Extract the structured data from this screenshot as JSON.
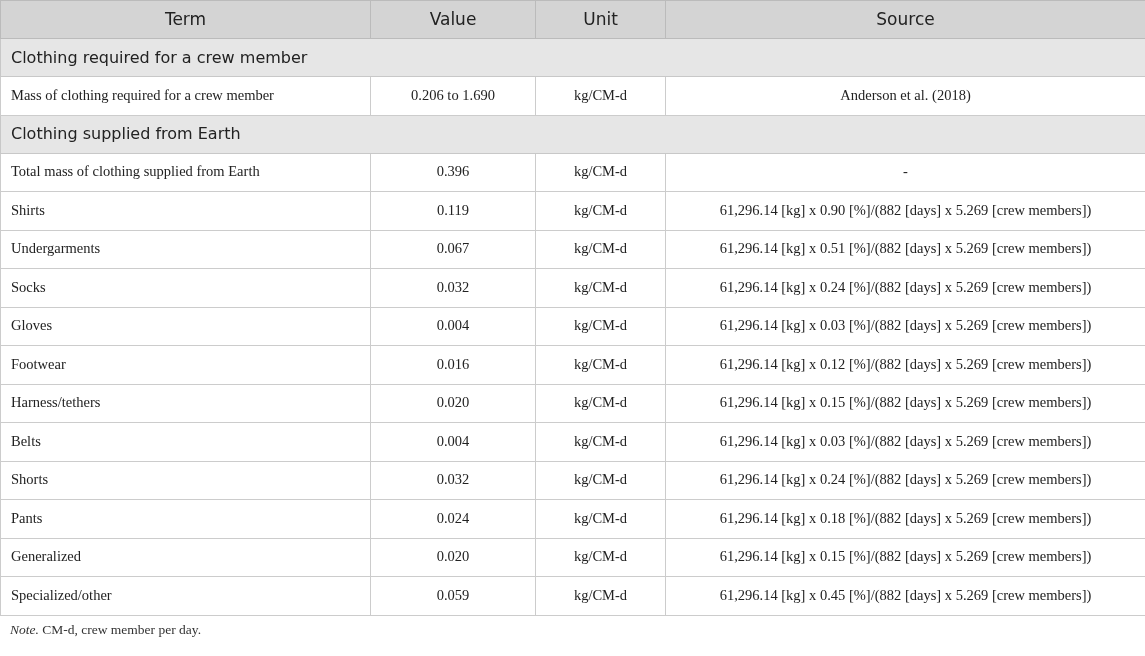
{
  "table": {
    "columns": [
      "Term",
      "Value",
      "Unit",
      "Source"
    ],
    "sections": [
      {
        "title": "Clothing required for a crew member",
        "rows": [
          {
            "term": "Mass of clothing required for a crew member",
            "value": "0.206 to 1.690",
            "unit": "kg/CM-d",
            "source": "Anderson et al. (2018)"
          }
        ]
      },
      {
        "title": "Clothing supplied from Earth",
        "rows": [
          {
            "term": "Total mass of clothing supplied from Earth",
            "value": "0.396",
            "unit": "kg/CM-d",
            "source": "-"
          },
          {
            "term": "Shirts",
            "value": "0.119",
            "unit": "kg/CM-d",
            "source": "61,296.14 [kg] x 0.90 [%]/(882 [days] x 5.269 [crew members])"
          },
          {
            "term": "Undergarments",
            "value": "0.067",
            "unit": "kg/CM-d",
            "source": "61,296.14 [kg] x 0.51 [%]/(882 [days] x 5.269 [crew members])"
          },
          {
            "term": "Socks",
            "value": "0.032",
            "unit": "kg/CM-d",
            "source": "61,296.14 [kg] x 0.24 [%]/(882 [days] x 5.269 [crew members])"
          },
          {
            "term": "Gloves",
            "value": "0.004",
            "unit": "kg/CM-d",
            "source": "61,296.14 [kg] x 0.03 [%]/(882 [days] x 5.269 [crew members])"
          },
          {
            "term": "Footwear",
            "value": "0.016",
            "unit": "kg/CM-d",
            "source": "61,296.14 [kg] x 0.12 [%]/(882 [days] x 5.269 [crew members])"
          },
          {
            "term": "Harness/tethers",
            "value": "0.020",
            "unit": "kg/CM-d",
            "source": "61,296.14 [kg] x 0.15 [%]/(882 [days] x 5.269 [crew members])"
          },
          {
            "term": "Belts",
            "value": "0.004",
            "unit": "kg/CM-d",
            "source": "61,296.14 [kg] x 0.03 [%]/(882 [days] x 5.269 [crew members])"
          },
          {
            "term": "Shorts",
            "value": "0.032",
            "unit": "kg/CM-d",
            "source": "61,296.14 [kg] x 0.24 [%]/(882 [days] x 5.269 [crew members])"
          },
          {
            "term": "Pants",
            "value": "0.024",
            "unit": "kg/CM-d",
            "source": "61,296.14 [kg] x 0.18 [%]/(882 [days] x 5.269 [crew members])"
          },
          {
            "term": "Generalized",
            "value": "0.020",
            "unit": "kg/CM-d",
            "source": "61,296.14 [kg] x 0.15 [%]/(882 [days] x 5.269 [crew members])"
          },
          {
            "term": "Specialized/other",
            "value": "0.059",
            "unit": "kg/CM-d",
            "source": "61,296.14 [kg] x 0.45 [%]/(882 [days] x 5.269 [crew members])"
          }
        ]
      }
    ]
  },
  "note": "*Note.* CM-d, crew member per day."
}
